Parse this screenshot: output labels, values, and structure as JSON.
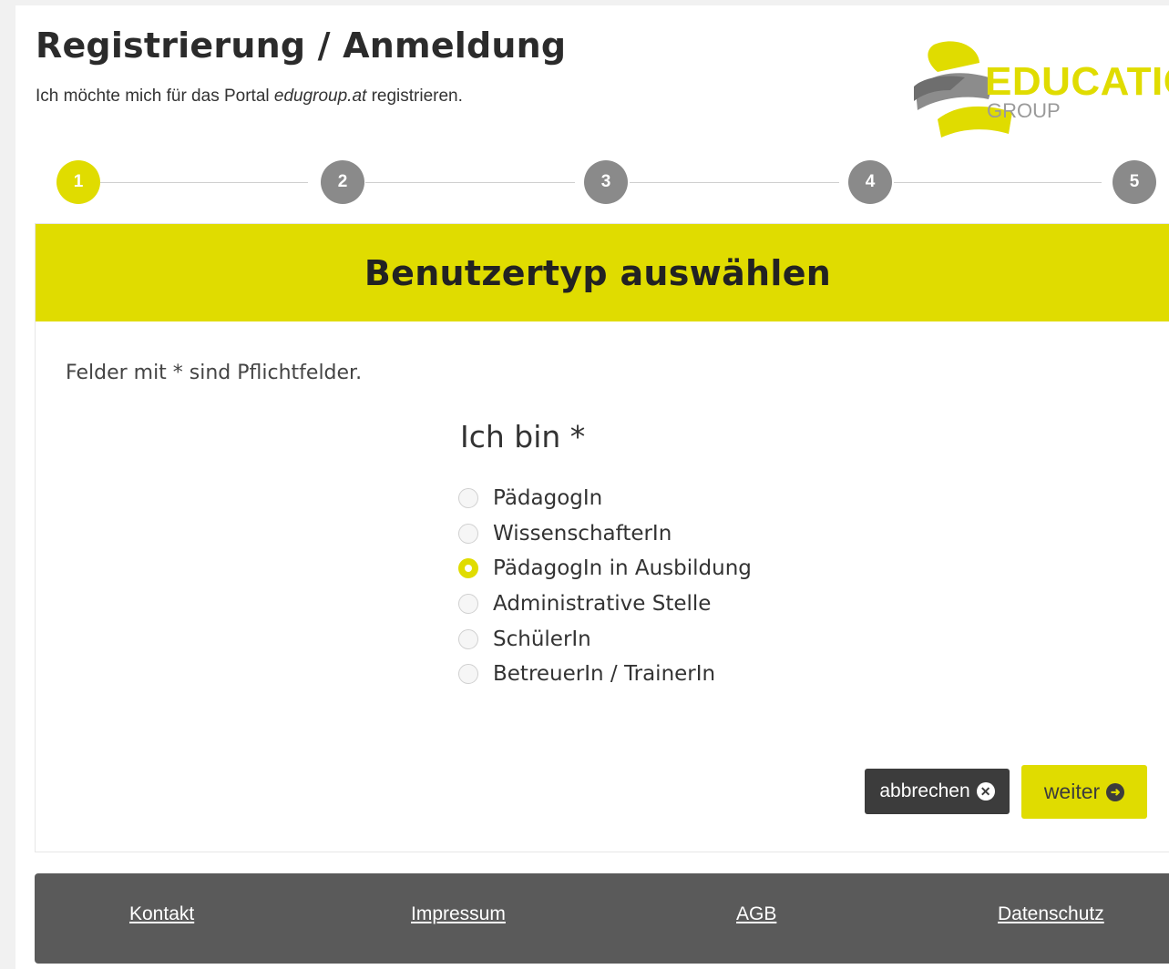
{
  "header": {
    "title": "Registrierung / Anmeldung",
    "subtitle_before": "Ich möchte mich für das Portal ",
    "subtitle_em": "edugroup.at",
    "subtitle_after": " registrieren.",
    "logo_text": "EDUCATION",
    "logo_sub": "GROUP"
  },
  "stepper": {
    "steps": [
      "1",
      "2",
      "3",
      "4",
      "5"
    ],
    "active": 1
  },
  "card": {
    "title": "Benutzertyp auswählen",
    "hint": "Felder mit * sind Pflichtfelder.",
    "field_label": "Ich bin *",
    "options": [
      {
        "label": "PädagogIn",
        "checked": false
      },
      {
        "label": "WissenschafterIn",
        "checked": false
      },
      {
        "label": "PädagogIn in Ausbildung",
        "checked": true
      },
      {
        "label": "Administrative Stelle",
        "checked": false
      },
      {
        "label": "SchülerIn",
        "checked": false
      },
      {
        "label": "BetreuerIn / TrainerIn",
        "checked": false
      }
    ]
  },
  "buttons": {
    "cancel": "abbrechen",
    "cancel_icon": "x-circle-icon",
    "next": "weiter",
    "next_icon": "arrow-circle-right-icon"
  },
  "footer": {
    "links": [
      "Kontakt",
      "Impressum",
      "AGB",
      "Datenschutz"
    ]
  },
  "colors": {
    "accent": "#e0dc00",
    "dark": "#3c3c3c",
    "footer_bg": "#5a5a5a",
    "step_inactive": "#8a8a8a"
  }
}
